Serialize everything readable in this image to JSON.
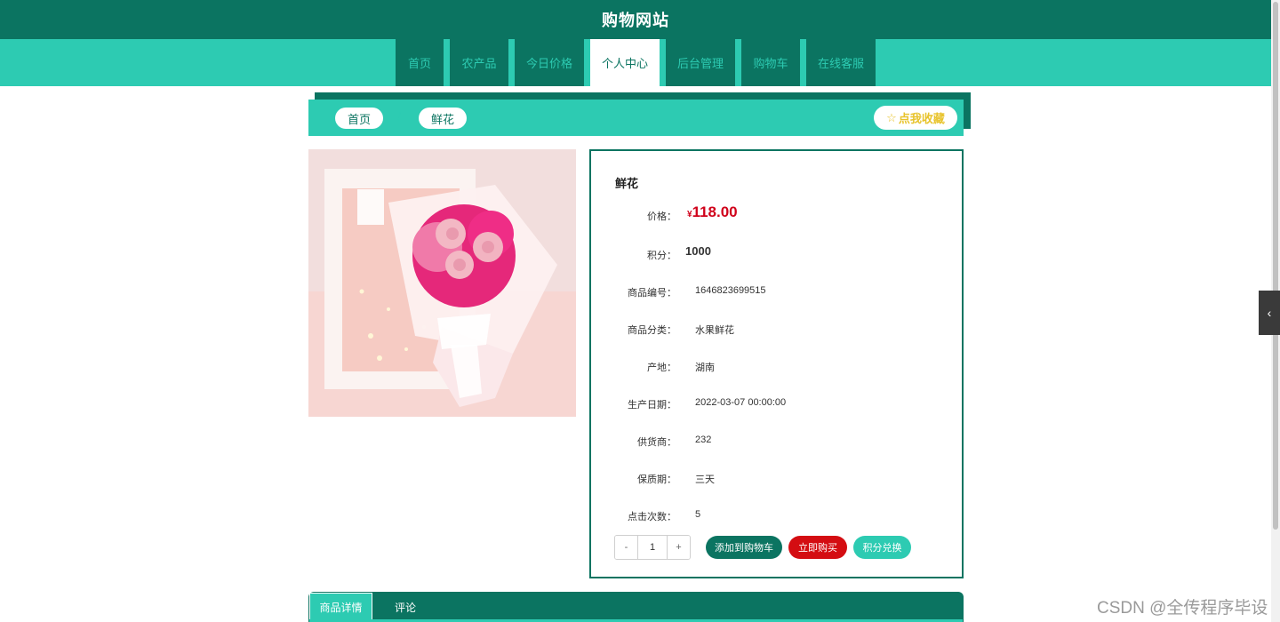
{
  "header": {
    "title": "购物网站"
  },
  "nav": {
    "items": [
      {
        "label": "首页"
      },
      {
        "label": "农产品"
      },
      {
        "label": "今日价格"
      },
      {
        "label": "个人中心"
      },
      {
        "label": "后台管理"
      },
      {
        "label": "购物车"
      },
      {
        "label": "在线客服"
      }
    ],
    "active_index": 3
  },
  "breadcrumb": {
    "home": "首页",
    "separator": "/",
    "current": "鲜花",
    "favorite_label": "点我收藏"
  },
  "product": {
    "name": "鲜花",
    "price_label": "价格：",
    "price_currency": "¥",
    "price": "118.00",
    "points_label": "积分：",
    "points": "1000",
    "fields": [
      {
        "label": "商品编号：",
        "value": "1646823699515"
      },
      {
        "label": "商品分类：",
        "value": "水果鲜花"
      },
      {
        "label": "产地：",
        "value": "湖南"
      },
      {
        "label": "生产日期：",
        "value": "2022-03-07 00:00:00"
      },
      {
        "label": "供货商：",
        "value": "232"
      },
      {
        "label": "保质期：",
        "value": "三天"
      },
      {
        "label": "点击次数：",
        "value": "5"
      }
    ]
  },
  "quantity": {
    "minus": "-",
    "value": "1",
    "plus": "+"
  },
  "actions": {
    "add_to_cart": "添加到购物车",
    "buy_now": "立即购买",
    "points_exchange": "积分兑换"
  },
  "tabs": [
    {
      "label": "商品详情"
    },
    {
      "label": "评论"
    }
  ],
  "watermark": "CSDN @全传程序毕设",
  "colors": {
    "primary_dark": "#0b7461",
    "primary_light": "#2dcbb2",
    "price_red": "#d0021b",
    "buy_red": "#d40d12",
    "favorite_gold": "#e8c32b"
  }
}
